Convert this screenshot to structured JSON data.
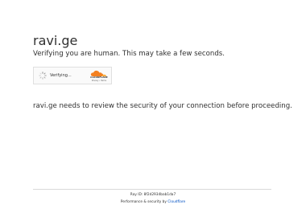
{
  "header": {
    "site_name": "ravi.ge",
    "subtitle": "Verifying you are human. This may take a few seconds."
  },
  "widget": {
    "status_text": "Verifying...",
    "brand_text": "CLOUDFLARE",
    "privacy_link": "Privacy",
    "terms_link": "Terms",
    "links_separator": "•"
  },
  "main": {
    "security_text": "ravi.ge needs to review the security of your connection before proceeding."
  },
  "footer": {
    "ray_id_text": "Ray ID: 8f2d2934bab1da7",
    "performance_prefix": "Performance & security by ",
    "performance_link": "Cloudflare"
  },
  "colors": {
    "text": "#313131",
    "link": "#0051c3",
    "cloudflare_orange": "#f38020",
    "cloudflare_orange_light": "#faae40"
  },
  "icons": {
    "spinner": "loading-spinner-icon",
    "cloudflare_logo": "cloudflare-cloud-icon"
  }
}
